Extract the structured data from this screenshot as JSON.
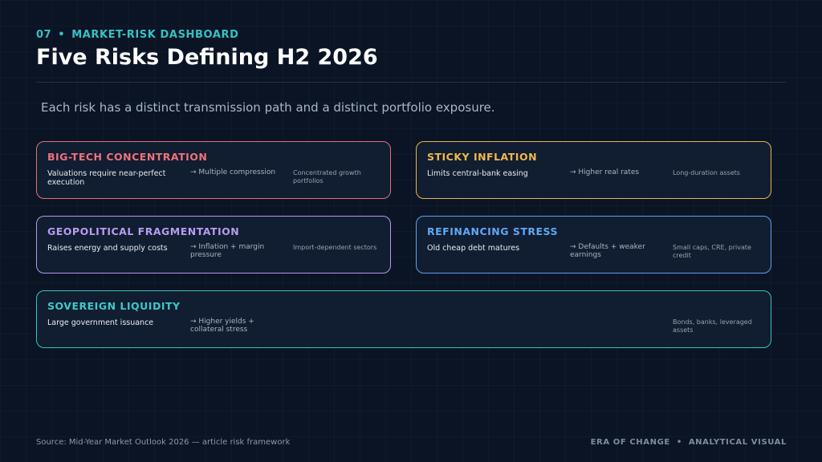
{
  "header": {
    "section_number": "07",
    "separator": "•",
    "section_label": "MARKET-RISK DASHBOARD",
    "title": "Five Risks Defining H2 2026",
    "subtitle": "Each risk has a distinct transmission path and a distinct portfolio exposure."
  },
  "risks": [
    {
      "title": "BIG-TECH CONCENTRATION",
      "effect": "Valuations require near-perfect execution",
      "channel": "→ Multiple compression",
      "exposure": "Concentrated growth portfolios",
      "color": "#ee727c"
    },
    {
      "title": "STICKY INFLATION",
      "effect": "Limits central-bank easing",
      "channel": "→ Higher real rates",
      "exposure": "Long-duration assets",
      "color": "#f2b84b"
    },
    {
      "title": "GEOPOLITICAL FRAGMENTATION",
      "effect": "Raises energy and supply costs",
      "channel": "→ Inflation + margin pressure",
      "exposure": "Import-dependent sectors",
      "color": "#b89cf0"
    },
    {
      "title": "REFINANCING STRESS",
      "effect": "Old cheap debt matures",
      "channel": "→ Defaults + weaker earnings",
      "exposure": "Small caps, CRE, private credit",
      "color": "#61a8f5"
    },
    {
      "title": "SOVEREIGN LIQUIDITY",
      "effect": "Large government issuance",
      "channel": "→ Higher yields + collateral stress",
      "exposure": "Bonds, banks, leveraged assets",
      "color": "#3cc9cb"
    }
  ],
  "footer": {
    "source": "Source: Mid-Year Market Outlook 2026 — article risk framework",
    "brand_left": "ERA OF CHANGE",
    "separator": "•",
    "brand_right": "ANALYTICAL VISUAL"
  }
}
